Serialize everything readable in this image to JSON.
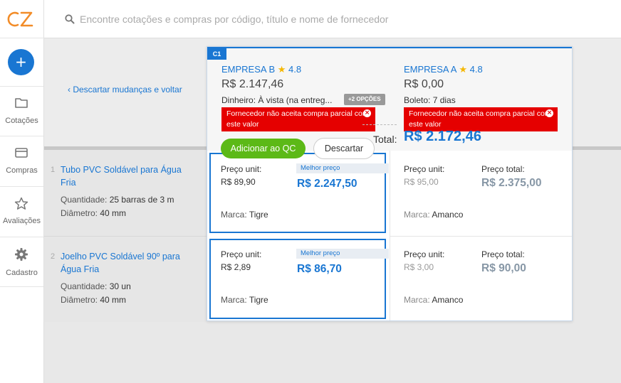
{
  "app": {
    "logo_text": "CZ"
  },
  "search": {
    "placeholder": "Encontre cotações e compras por código, título e nome de fornecedor"
  },
  "sidebar": {
    "new_button": "+",
    "items": [
      {
        "label": "Cotações",
        "icon": "folder-icon"
      },
      {
        "label": "Compras",
        "icon": "card-icon"
      },
      {
        "label": "Avaliações",
        "icon": "star-icon"
      },
      {
        "label": "Cadastro",
        "icon": "gear-icon"
      }
    ]
  },
  "header": {
    "back_link": "‹ Descartar mudanças e voltar"
  },
  "panel": {
    "tag": "C1",
    "total_label": "Total:",
    "total_value": "R$ 2.172,46",
    "add_button": "Adicionar ao QC",
    "discard_button": "Descartar",
    "suppliers": [
      {
        "name": "EMPRESA B",
        "rating": "4.8",
        "total": "R$ 2.147,46",
        "payment": "Dinheiro: À vista (na entreg...",
        "options_badge": "+2 OPÇÕES",
        "warning": "Fornecedor não aceita compra parcial com este valor"
      },
      {
        "name": "EMPRESA A",
        "rating": "4.8",
        "total": "R$ 0,00",
        "payment": "Boleto: 7 dias",
        "warning": "Fornecedor não aceita compra parcial com este valor"
      }
    ],
    "labels": {
      "unit": "Preço unit:",
      "total": "Preço total:",
      "brand": "Marca:",
      "best": "Melhor preço"
    }
  },
  "products": [
    {
      "num": "1",
      "title": "Tubo PVC Soldável para Água Fria",
      "qty_label": "Quantidade:",
      "qty": "25 barras de 3 m",
      "diam_label": "Diâmetro:",
      "diam": "40 mm",
      "offers": [
        {
          "unit": "R$ 89,90",
          "total": "R$ 2.247,50",
          "brand": "Tigre"
        },
        {
          "unit": "R$ 95,00",
          "total": "R$ 2.375,00",
          "brand": "Amanco"
        }
      ]
    },
    {
      "num": "2",
      "title": "Joelho PVC Soldável 90º para Água Fria",
      "qty_label": "Quantidade:",
      "qty": "30 un",
      "diam_label": "Diâmetro:",
      "diam": "40 mm",
      "offers": [
        {
          "unit": "R$ 2,89",
          "total": "R$ 86,70",
          "brand": "Tigre"
        },
        {
          "unit": "R$ 3,00",
          "total": "R$ 90,00",
          "brand": "Amanco"
        }
      ]
    }
  ],
  "colors": {
    "primary": "#1976d2",
    "success": "#5cb917",
    "danger": "#e50000",
    "star": "#f5b700",
    "logo": "#f28c28"
  }
}
